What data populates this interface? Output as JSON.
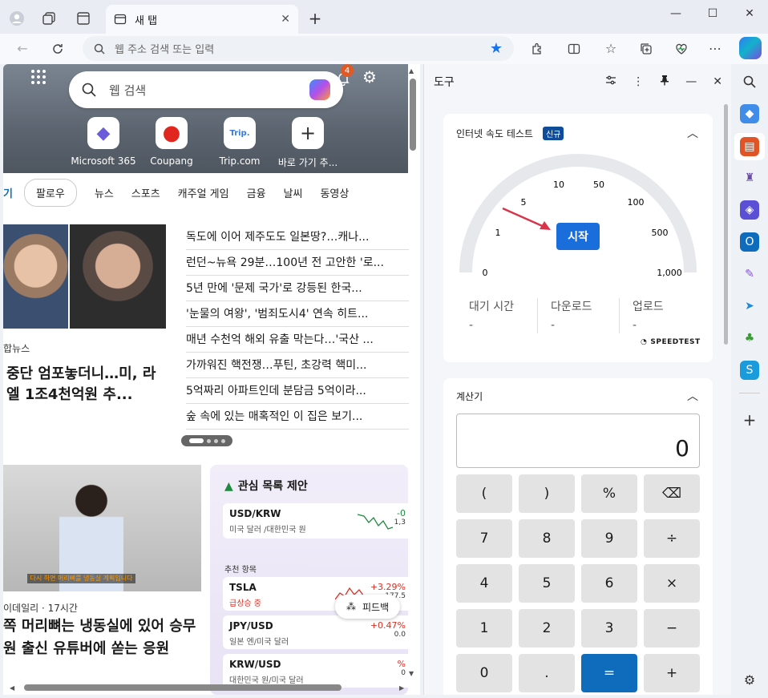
{
  "tab": {
    "title": "새 탭"
  },
  "address": {
    "placeholder": "웹 주소 검색 또는 입력"
  },
  "ntp": {
    "search_placeholder": "웹 검색",
    "notif_count": "4",
    "quicklinks": [
      {
        "label": "Microsoft 365",
        "glyph": "◆",
        "color": "#6b5cd9"
      },
      {
        "label": "Coupang",
        "glyph": "●",
        "color": "#e0261e"
      },
      {
        "label": "Trip.com",
        "glyph": "Trip.",
        "color": "#3a79e0"
      },
      {
        "label": "바로 가기 추...",
        "glyph": "+",
        "color": "#333333"
      }
    ],
    "feed_tabs": {
      "active": "기",
      "pill": "팔로우",
      "items": [
        "뉴스",
        "스포츠",
        "캐주얼 게임",
        "금융",
        "날씨",
        "동영상"
      ]
    },
    "top_story": {
      "source": "합뉴스",
      "title": "중단 엄포놓더니…미, 라엘 1조4천억원 추..."
    },
    "headlines": [
      "독도에 이어 제주도도 일본땅?…캐나...",
      "런던~뉴욕 29분…100년 전 고안한 '로...",
      "5년 만에 '문제 국가'로 강등된 한국...",
      "'눈물의 여왕', '범죄도시4' 연속 히트...",
      "매년 수천억 해외 유출 막는다…'국산 ...",
      "가까워진 핵전쟁…푸틴, 초강력 핵미...",
      "5억짜리 아파트인데 분담금 5억이라...",
      "숲 속에 있는 매혹적인 이 집은 보기..."
    ],
    "card2": {
      "meta": "이데일리 · 17시간",
      "title": "쪽 머리뼈는 냉동실에 있어 승무원 출신 유튜버에 쏟는 응원",
      "caption": "다시 하면 머리뼈를 냉동실 계획입니다"
    },
    "watchlist": {
      "title": "관심 목록 제안",
      "first": {
        "sym": "USD/KRW",
        "sub": "미국 달러 /대한민국 원",
        "chg": "-0",
        "price": "1,3"
      },
      "rec_label": "추천 항목",
      "items": [
        {
          "sym": "TSLA",
          "sub": "급상승 중",
          "chg": "+3.29%",
          "price": "177.5"
        },
        {
          "sym": "JPY/USD",
          "sub": "일본 엔/미국 달러",
          "chg": "+0.47%",
          "price": "0.0"
        },
        {
          "sym": "KRW/USD",
          "sub": "대한민국 원/미국 달러",
          "chg": "%",
          "price": "0"
        }
      ]
    },
    "feedback": "피드백"
  },
  "pane": {
    "title": "도구",
    "speedtest": {
      "title": "인터넷 속도 테스트",
      "badge": "신규",
      "start": "시작",
      "labels": [
        "0",
        "1",
        "5",
        "10",
        "50",
        "100",
        "500",
        "1,000"
      ],
      "stats": [
        {
          "label": "대기 시간",
          "value": "-"
        },
        {
          "label": "다운로드",
          "value": "-"
        },
        {
          "label": "업로드",
          "value": "-"
        }
      ],
      "brand": "SPEEDTEST"
    },
    "calculator": {
      "title": "계산기",
      "display": "0",
      "keys": [
        "(",
        ")",
        "%",
        "⌫",
        "7",
        "8",
        "9",
        "÷",
        "4",
        "5",
        "6",
        "×",
        "1",
        "2",
        "3",
        "−",
        "0",
        ".",
        "=",
        "+"
      ]
    }
  },
  "colors": {
    "accent": "#1a6edb",
    "eq_key": "#0f6cbd",
    "up": "#1d8a3e",
    "down": "#d93025"
  }
}
